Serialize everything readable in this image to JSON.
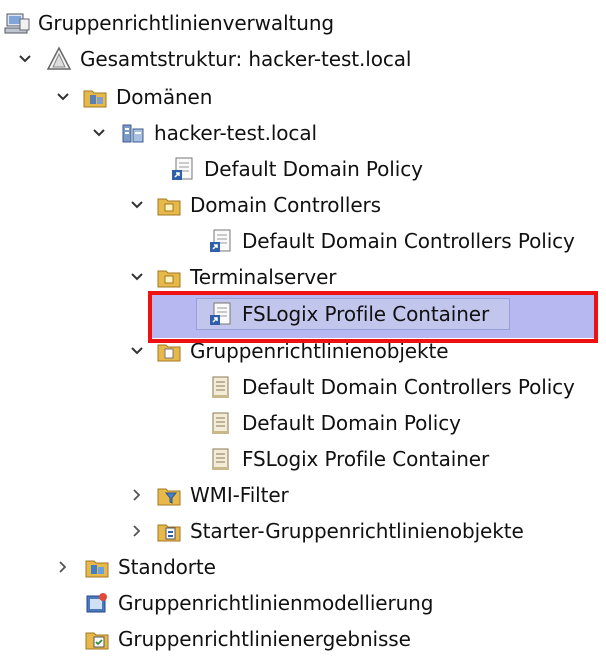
{
  "tree": {
    "root": {
      "label": "Gruppenrichtlinienverwaltung",
      "icon": "gpmc-console-icon"
    },
    "forest": {
      "label": "Gesamtstruktur: hacker-test.local",
      "icon": "forest-icon"
    },
    "domains": {
      "label": "Domänen",
      "icon": "domains-folder-icon"
    },
    "domain": {
      "label": "hacker-test.local",
      "icon": "domain-icon"
    },
    "default_domain_policy_link": {
      "label": "Default Domain Policy",
      "icon": "gpo-link-icon"
    },
    "domain_controllers": {
      "label": "Domain Controllers",
      "icon": "ou-icon"
    },
    "ddcp_link": {
      "label": "Default Domain Controllers Policy",
      "icon": "gpo-link-icon"
    },
    "terminalserver": {
      "label": "Terminalserver",
      "icon": "ou-icon"
    },
    "fslogix_link": {
      "label": "FSLogix Profile Container",
      "icon": "gpo-link-icon"
    },
    "gpo_container": {
      "label": "Gruppenrichtlinienobjekte",
      "icon": "gpo-folder-icon"
    },
    "gpo_ddcp": {
      "label": "Default Domain Controllers Policy",
      "icon": "gpo-icon"
    },
    "gpo_ddp": {
      "label": "Default Domain Policy",
      "icon": "gpo-icon"
    },
    "gpo_fslogix": {
      "label": "FSLogix Profile Container",
      "icon": "gpo-icon"
    },
    "wmi_filter": {
      "label": "WMI-Filter",
      "icon": "wmi-filter-icon"
    },
    "starter_gpos": {
      "label": "Starter-Gruppenrichtlinienobjekte",
      "icon": "starter-gpo-icon"
    },
    "sites": {
      "label": "Standorte",
      "icon": "sites-icon"
    },
    "modeling": {
      "label": "Gruppenrichtlinienmodellierung",
      "icon": "modeling-icon"
    },
    "results": {
      "label": "Gruppenrichtlinienergebnisse",
      "icon": "results-icon"
    }
  },
  "colors": {
    "selection": "#c3c6ec",
    "highlight_overlay": "#aaaaf0",
    "highlight_border": "#ee1111"
  }
}
